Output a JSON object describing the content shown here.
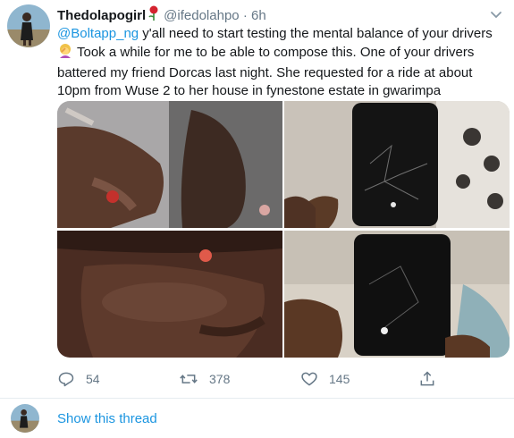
{
  "tweet": {
    "display_name": "Thedolapogirl",
    "handle": "@ifedolahpo",
    "separator": "·",
    "time": "6h",
    "mention": "@Boltapp_ng",
    "text_line1_rest": " y'all need to start testing the mental balance of your drivers",
    "text_line2": "Took a while for me to be able to compose this. One of your drivers battered my friend Dorcas last night. She requested for a ride at about 10pm from Wuse 2 to her house in fynestone estate in gwarimpa"
  },
  "actions": {
    "replies": "54",
    "retweets": "378",
    "likes": "145"
  },
  "thread": {
    "show_label": "Show this thread"
  },
  "colors": {
    "link": "#1b95e0",
    "muted": "#657786",
    "text": "#14171a",
    "divider": "#e6ecf0"
  },
  "icons": [
    "rose-emoji",
    "woman-facepalming-emoji",
    "caret-down-icon",
    "reply-icon",
    "retweet-icon",
    "like-icon",
    "share-icon"
  ]
}
